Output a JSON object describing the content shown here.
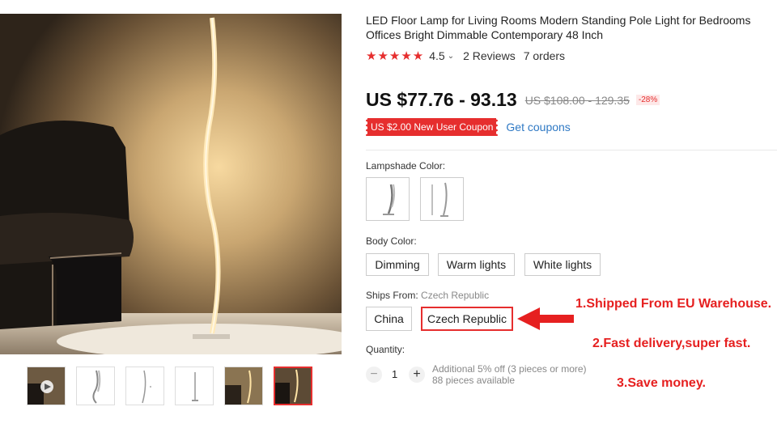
{
  "product": {
    "title": "LED Floor Lamp for Living Rooms Modern Standing Pole Light for Bedrooms Offices Bright Dimmable Contemporary 48 Inch",
    "rating": {
      "stars": "★★★★★",
      "score": "4.5",
      "chevron": "⌄",
      "reviews": "2 Reviews",
      "orders": "7 orders"
    },
    "price": {
      "current": "US $77.76 - 93.13",
      "original": "US $108.00 - 129.35",
      "discount": "-28%"
    },
    "coupon": {
      "label": "US $2.00 New User Coupon",
      "link": "Get coupons"
    }
  },
  "options": {
    "lampshade": {
      "label": "Lampshade Color:",
      "swatch_icons": [
        "lamp-white-icon",
        "lamp-silver-icon"
      ]
    },
    "body_color": {
      "label": "Body Color:",
      "items": [
        "Dimming",
        "Warm lights",
        "White lights"
      ]
    },
    "ships_from": {
      "label": "Ships From:",
      "value": "Czech Republic",
      "items": [
        "China",
        "Czech Republic"
      ],
      "selected": "Czech Republic"
    }
  },
  "quantity": {
    "label": "Quantity:",
    "minus": "−",
    "plus": "+",
    "value": "1",
    "extra": "Additional 5% off (3 pieces or more)",
    "available": "88 pieces available"
  },
  "annotations": {
    "line1": "1.Shipped From EU Warehouse.",
    "line2": "2.Fast delivery,super fast.",
    "line3": "3.Save money."
  },
  "colors": {
    "accent": "#e62e2e",
    "link": "#2f79c4",
    "annotation": "#e62020"
  },
  "gallery": {
    "thumbnails": 6,
    "selected_index": 5
  }
}
